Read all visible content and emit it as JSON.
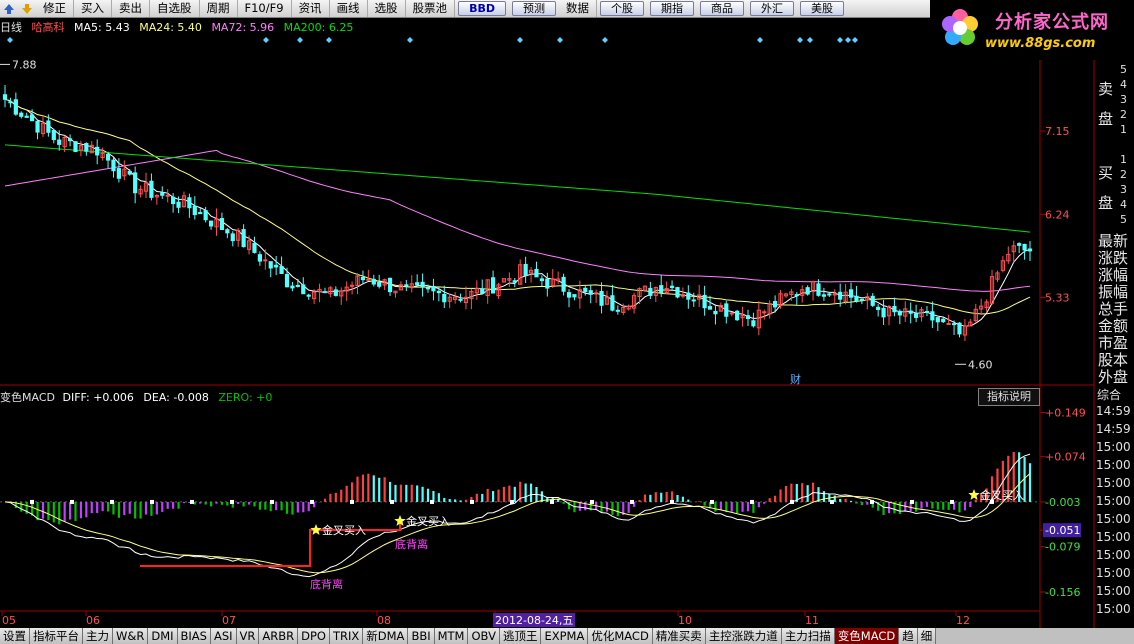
{
  "toolbar": {
    "items": [
      "修正",
      "买入",
      "卖出",
      "自选股",
      "周期",
      "F10/F9",
      "资讯",
      "画线",
      "选股",
      "股票池"
    ],
    "buttons": [
      "BBD",
      "预测",
      "数据",
      "个股",
      "期指",
      "商品",
      "外汇",
      "美股"
    ]
  },
  "logo": {
    "title": "分析家公式网",
    "url": "www.88gs.com"
  },
  "price_header": {
    "period": "日线",
    "name": "哈高科",
    "ma5": "MA5: 5.43",
    "ma24": "MA24: 5.40",
    "ma72": "MA72: 5.96",
    "ma200": "MA200: 6.25"
  },
  "macd_header": {
    "name": "变色MACD",
    "diff": "DIFF: +0.006",
    "dea": "DEA: -0.008",
    "zero": "ZERO: +0"
  },
  "indicator_button": "指标说明",
  "right_panel": {
    "sell": [
      "卖",
      "盘"
    ],
    "buy": [
      "买",
      "盘"
    ],
    "nums_sell": [
      "5",
      "4",
      "3",
      "2",
      "1"
    ],
    "nums_buy": [
      "1",
      "2",
      "3",
      "4",
      "5"
    ],
    "rows": [
      "最新",
      "涨跌",
      "涨幅",
      "振幅",
      "总手",
      "金额",
      "市盈",
      "股本",
      "外盘"
    ],
    "tab": "综合",
    "times": [
      "14:59",
      "14:59",
      "15:00",
      "15:00",
      "15:00",
      "15:00",
      "15:00",
      "15:00",
      "15:00",
      "15:00",
      "15:00",
      "15:00"
    ]
  },
  "bottom_tabs": [
    "设置",
    "指标平台",
    "主力",
    "W&R",
    "DMI",
    "BIAS",
    "ASI",
    "VR",
    "ARBR",
    "DPO",
    "TRIX",
    "新DMA",
    "BBI",
    "MTM",
    "OBV",
    "逃顶王",
    "EXPMA",
    "优化MACD",
    "精准买卖",
    "主控涨跌力道",
    "主力扫描",
    "变色MACD",
    "趋",
    "细"
  ],
  "active_tab": "变色MACD",
  "chart_data": {
    "type": "candlestick",
    "price_axis": {
      "labels": [
        "7.15",
        "6.24",
        "5.33"
      ],
      "ylim": [
        4.45,
        7.95
      ]
    },
    "high_label": "7.88",
    "low_label": "4.60",
    "finance_marker": "财",
    "x_labels": [
      "05",
      "06",
      "07",
      "08",
      "2012-08-24,五",
      "10",
      "11",
      "12"
    ],
    "macd_axis": {
      "labels": [
        "+0.149",
        "+0.074",
        "-0.003",
        "-0.051",
        "-0.079",
        "-0.156"
      ],
      "ylim": [
        -0.19,
        0.16
      ],
      "highlight": "-0.051"
    },
    "annotations": {
      "golden_cross": "金叉买入",
      "divergence": "底背离"
    },
    "colors": {
      "up": "#ff5050",
      "down": "#54ffff",
      "ma5": "#ffffff",
      "ma24": "#ffff80",
      "ma72": "#ff80ff",
      "ma200": "#00e000"
    }
  }
}
